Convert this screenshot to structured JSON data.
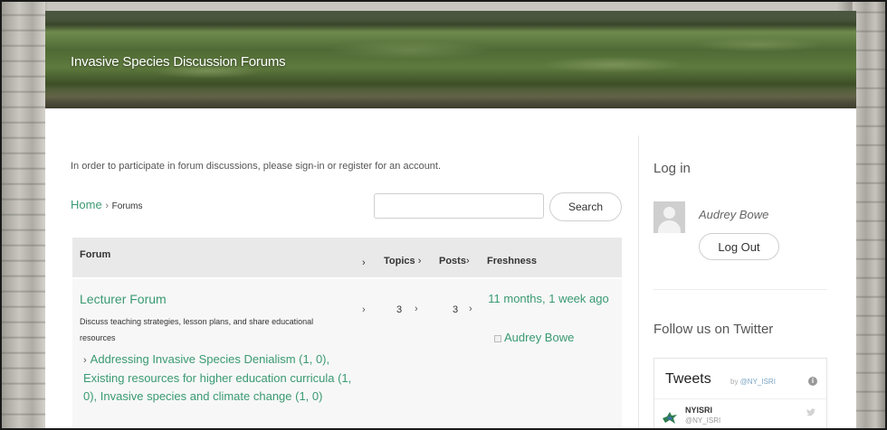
{
  "banner": {
    "title": "Invasive Species Discussion Forums"
  },
  "notice": "In order to participate in forum discussions, please sign-in or register for an account.",
  "breadcrumb": {
    "home": "Home",
    "separator": "›",
    "current": "Forums"
  },
  "search": {
    "value": "",
    "button_label": "Search"
  },
  "table": {
    "headers": {
      "forum": "Forum",
      "topics": "Topics",
      "posts": "Posts",
      "freshness": "Freshness",
      "arrow": "›"
    },
    "rows": [
      {
        "title": "Lecturer Forum",
        "description": "Discuss teaching strategies, lesson plans, and share educational resources",
        "topics": "3",
        "posts": "3",
        "freshness": "11 months, 1 week ago",
        "freshness_author": "Audrey Bowe",
        "subforums": "Addressing Invasive Species Denialism (1, 0), Existing resources for higher education curricula (1, 0), Invasive species and climate change (1, 0)"
      }
    ]
  },
  "sidebar": {
    "login_heading": "Log in",
    "user_name": "Audrey Bowe",
    "logout_label": "Log Out",
    "follow_heading": "Follow us on Twitter",
    "tweets": {
      "title": "Tweets",
      "by_prefix": "by",
      "by_handle": "@NY_ISRI",
      "account_name": "NYISRI",
      "account_handle": "@NY_ISRI"
    }
  },
  "colors": {
    "accent": "#3a9a72",
    "table_header_bg": "#e9e9e9",
    "table_row_bg": "#f7f7f7"
  }
}
